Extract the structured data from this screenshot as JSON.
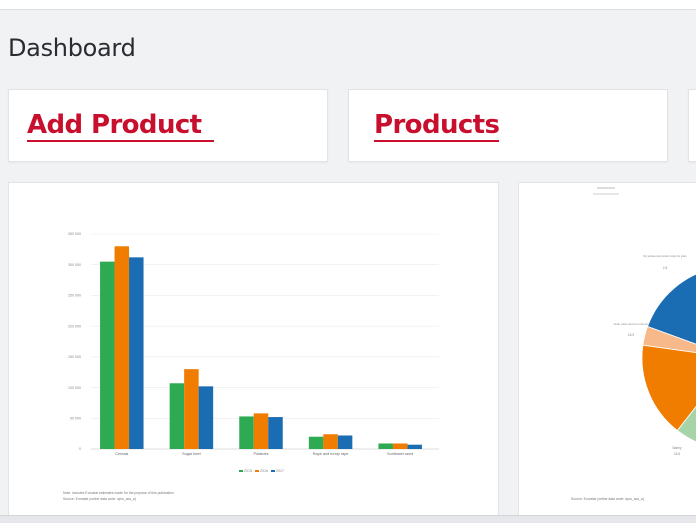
{
  "page": {
    "title": "Dashboard"
  },
  "cards": [
    {
      "label": "Add Product "
    },
    {
      "label": "Products"
    }
  ],
  "chart_data": [
    {
      "type": "bar",
      "categories": [
        "Cereals",
        "Sugar beet",
        "Potatoes",
        "Rape and turnip rape",
        "Sunflower seed"
      ],
      "series": [
        {
          "name": "2015",
          "color": "#2eaa52",
          "values": [
            305,
            107,
            53,
            20,
            9
          ]
        },
        {
          "name": "2016",
          "color": "#f07d00",
          "values": [
            330,
            130,
            58,
            24,
            9
          ]
        },
        {
          "name": "2017",
          "color": "#1b6db3",
          "values": [
            312,
            102,
            52,
            22,
            7
          ]
        }
      ],
      "yticks": [
        "350 000",
        "300 000",
        "250 000",
        "200 000",
        "150 000",
        "100 000",
        "50 000",
        "0"
      ],
      "ylim": [
        0,
        350
      ],
      "legend_position": "bottom",
      "notes": [
        "Note: includes Eurostat estimates made for the purpose of this publication",
        "Source: Eurostat (online data code: apro_acs_a)"
      ]
    },
    {
      "type": "pie",
      "labels": [
        "Dry pulses and protein crops for grain",
        "Grain maize and corn-cob-mix",
        "Barley"
      ],
      "values_text": [
        "2.8",
        "18.5",
        "18.6"
      ],
      "notes": [
        "Source: Eurostat (online data code: apro_acs_a)"
      ]
    }
  ],
  "colors": {
    "accent": "#c8102e",
    "green": "#2eaa52",
    "orange": "#f07d00",
    "blue": "#1b6db3"
  }
}
